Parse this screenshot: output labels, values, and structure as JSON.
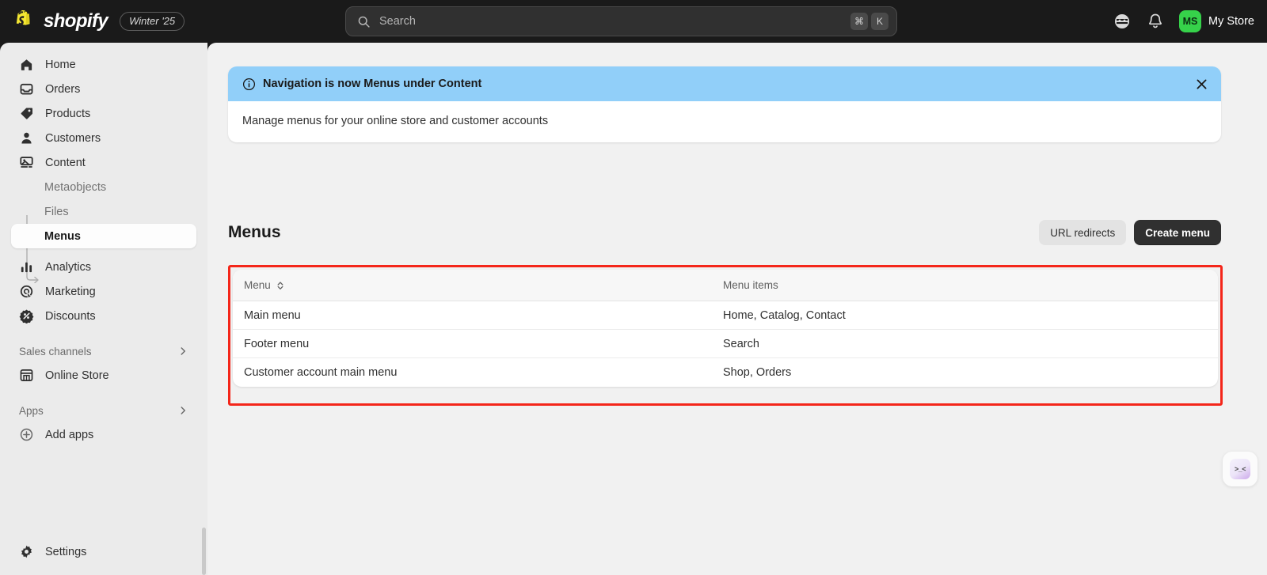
{
  "topbar": {
    "brand_name": "shopify",
    "version_badge": "Winter '25",
    "search": {
      "placeholder": "Search",
      "kbd_modifier": "⌘",
      "kbd_key": "K"
    },
    "store_initials": "MS",
    "store_name": "My Store"
  },
  "sidebar": {
    "items": [
      {
        "label": "Home",
        "icon": "home-icon"
      },
      {
        "label": "Orders",
        "icon": "orders-icon"
      },
      {
        "label": "Products",
        "icon": "products-tag-icon"
      },
      {
        "label": "Customers",
        "icon": "customers-person-icon"
      },
      {
        "label": "Content",
        "icon": "content-media-icon"
      }
    ],
    "content_children": [
      {
        "label": "Metaobjects",
        "active": false
      },
      {
        "label": "Files",
        "active": false
      },
      {
        "label": "Menus",
        "active": true
      }
    ],
    "items_lower": [
      {
        "label": "Analytics",
        "icon": "analytics-bars-icon"
      },
      {
        "label": "Marketing",
        "icon": "marketing-target-icon"
      },
      {
        "label": "Discounts",
        "icon": "discounts-badge-icon"
      }
    ],
    "sales_channels_header": "Sales channels",
    "online_store": "Online Store",
    "apps_header": "Apps",
    "add_apps": "Add apps",
    "settings": "Settings"
  },
  "banner": {
    "title": "Navigation is now Menus under Content",
    "body": "Manage menus for your online store and customer accounts",
    "header_color": "#91CFF9"
  },
  "page": {
    "title": "Menus",
    "url_redirects_label": "URL redirects",
    "create_menu_label": "Create menu"
  },
  "table": {
    "columns": {
      "menu": "Menu",
      "menu_items": "Menu items"
    },
    "rows": [
      {
        "menu": "Main menu",
        "items": "Home, Catalog, Contact"
      },
      {
        "menu": "Footer menu",
        "items": "Search"
      },
      {
        "menu": "Customer account main menu",
        "items": "Shop, Orders"
      }
    ]
  },
  "sidekick": {
    "face": "&gt;_&lt;"
  },
  "annotation": {
    "highlight_color": "#F4261A"
  }
}
